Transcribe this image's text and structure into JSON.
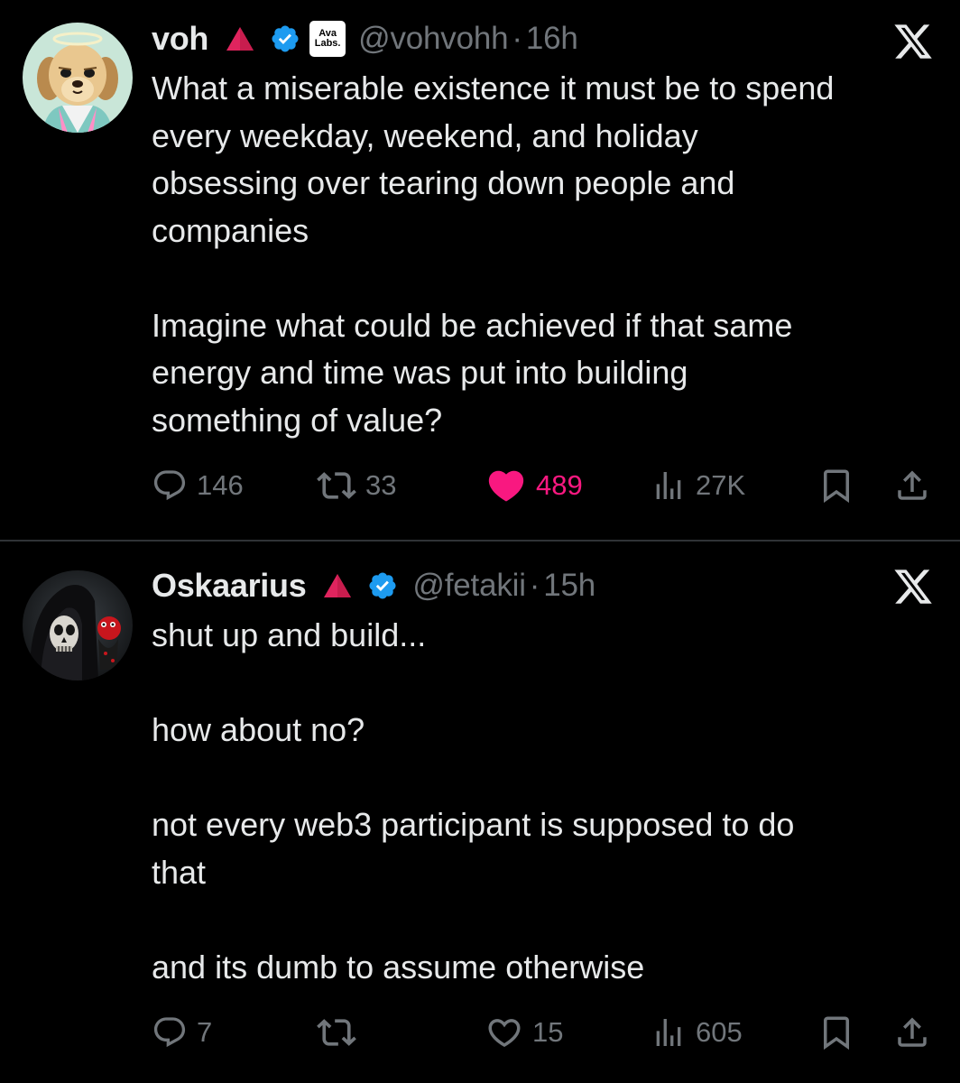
{
  "tweets": [
    {
      "display_name": "voh",
      "affiliate_badge": [
        "Ava",
        "Labs."
      ],
      "handle": "@vohvohh",
      "time": "16h",
      "separator": "·",
      "text": "What a miserable existence it must be to spend\nevery weekday, weekend, and holiday\nobsessing over tearing down people and\ncompanies\n\nImagine what could be achieved if that same\nenergy and time was put into building\nsomething of value?",
      "replies": "146",
      "reposts": "33",
      "likes": "489",
      "liked": true,
      "views": "27K"
    },
    {
      "display_name": "Oskaarius",
      "handle": "@fetakii",
      "time": "15h",
      "separator": "·",
      "text": "shut up and build...\n\nhow about no?\n\nnot every web3 participant is supposed to do\nthat\n\nand its dumb to assume otherwise",
      "replies": "7",
      "reposts": "",
      "likes": "15",
      "liked": false,
      "views": "605"
    }
  ],
  "colors": {
    "background": "#000000",
    "text": "#e7e9ea",
    "secondary": "#71767b",
    "verified": "#1d9bf0",
    "like": "#f91880",
    "badge_triangle": "#e0245e"
  },
  "icons": [
    "reply-icon",
    "repost-icon",
    "like-icon",
    "views-icon",
    "bookmark-icon",
    "share-icon",
    "x-logo-icon",
    "verified-icon",
    "triangle-icon"
  ]
}
